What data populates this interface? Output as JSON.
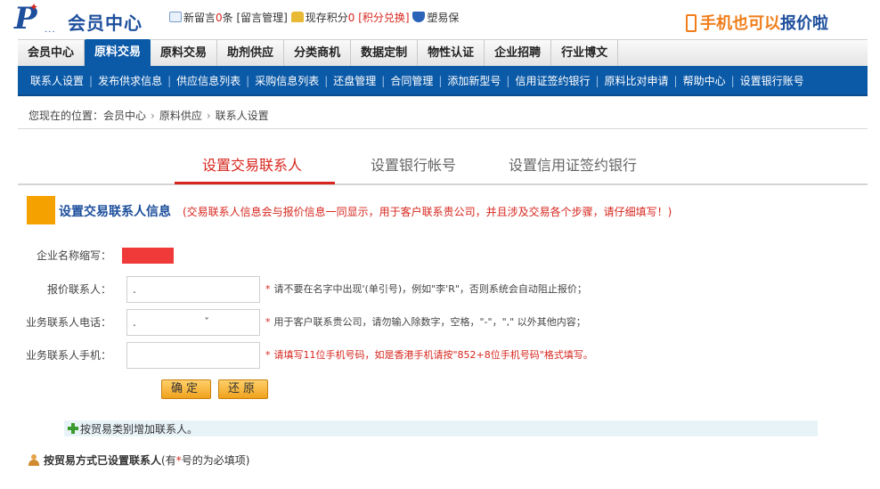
{
  "brand": {
    "logo_mark": "P",
    "logo_dots": "...",
    "logo_text": "会员中心"
  },
  "topinfo": {
    "new_msg_prefix": "新留言",
    "new_msg_count": "0",
    "new_msg_suffix": "条",
    "msg_manage": "[留言管理]",
    "points_prefix": "现存积分",
    "points_value": "0",
    "points_exchange": "[积分兑换]",
    "suyibao": "塑易保"
  },
  "mobile": {
    "text": "手机也可以",
    "highlight": "报价啦"
  },
  "mainnav": [
    "会员中心",
    "原料交易",
    "原料交易",
    "助剂供应",
    "分类商机",
    "数据定制",
    "物性认证",
    "企业招聘",
    "行业博文"
  ],
  "subnav": [
    "联系人设置",
    "发布供求信息",
    "供应信息列表",
    "采购信息列表",
    "还盘管理",
    "合同管理",
    "添加新型号",
    "信用证签约银行",
    "原料比对申请",
    "帮助中心",
    "设置银行账号"
  ],
  "breadcrumb": {
    "prefix": "您现在的位置：",
    "items": [
      "会员中心",
      "原料供应",
      "联系人设置"
    ]
  },
  "tabs": [
    "设置交易联系人",
    "设置银行帐号",
    "设置信用证签约银行"
  ],
  "section": {
    "title": "设置交易联系人信息",
    "note": "(交易联系人信息会与报价信息一同显示，用于客户联系贵公司，并且涉及交易各个步骤，请仔细填写！)"
  },
  "form": {
    "company_label": "企业名称缩写：",
    "contact_label": "报价联系人：",
    "contact_value": ".",
    "contact_hint": "请不要在名字中出现'(单引号)，例如\"李'R\"，否则系统会自动阻止报价；",
    "phone_label": "业务联系人电话：",
    "phone_value": ".                    ˇ",
    "phone_hint": "用于客户联系贵公司，请勿输入除数字，空格，\"-\"，\",\" 以外其他内容；",
    "mobile_label": "业务联系人手机：",
    "mobile_value": "",
    "mobile_hint": "请填写11位手机号码，如是香港手机请按\"852+8位手机号码\"格式填写。",
    "star": "*"
  },
  "buttons": {
    "confirm": "确定",
    "reset": "还原"
  },
  "add_contact": "按贸易类别增加联系人。",
  "list_head": {
    "title": "按贸易方式已设置联系人",
    "note_prefix": "(有",
    "note_star": "*",
    "note_suffix": "号的为必填项)"
  },
  "colors": {
    "brand_blue": "#1d4f9c",
    "nav_blue": "#0b5aa8",
    "accent_red": "#d7261e",
    "accent_orange": "#f5a100"
  }
}
